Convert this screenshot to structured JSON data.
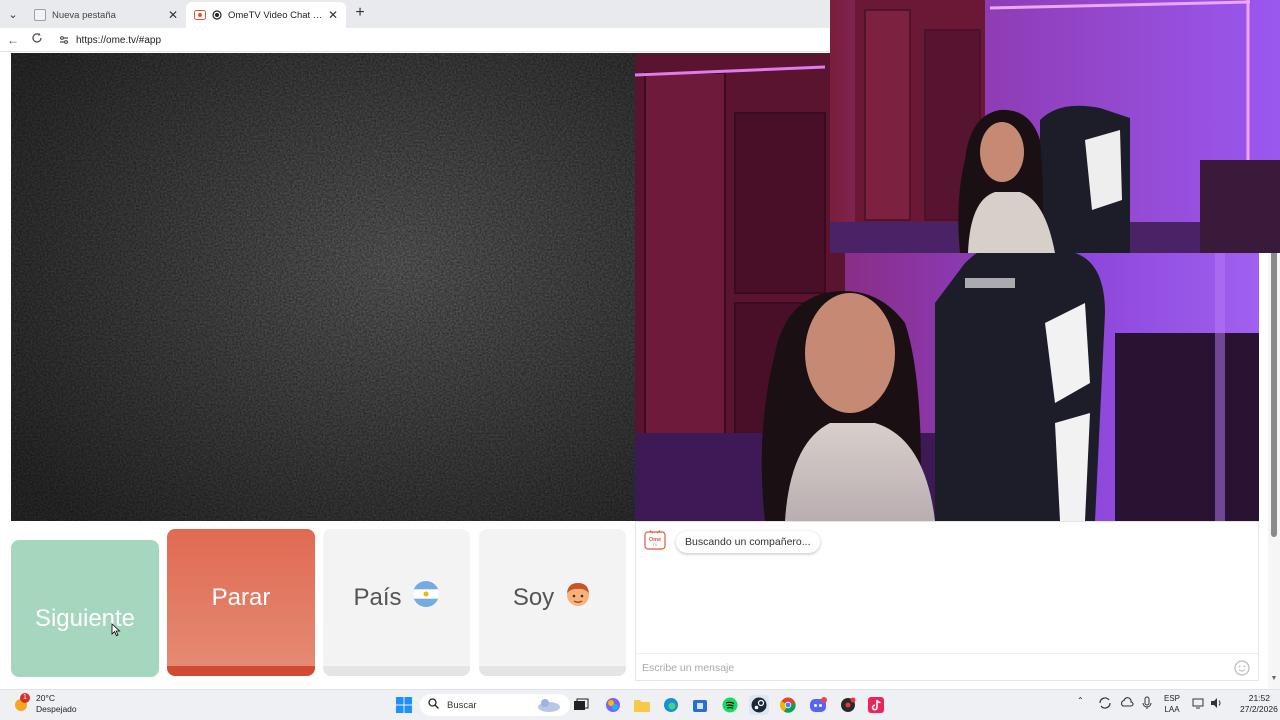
{
  "browser": {
    "tabs": [
      {
        "label": "Nueva pestaña",
        "active": false
      },
      {
        "label": "OmeTV Video Chat — Omeg",
        "active": true
      }
    ],
    "url": "https://ome.tv/#app"
  },
  "controls": {
    "next_label": "Siguiente",
    "stop_label": "Parar",
    "country_label": "País",
    "country_flag": "🇦🇷",
    "gender_label": "Soy",
    "gender_emoji": "👦"
  },
  "chat": {
    "logo_text": "Ome",
    "logo_sub": "TV",
    "status": "Buscando un compañero...",
    "input_placeholder": "Escribe un mensaje"
  },
  "colors": {
    "next": "#a5d7bf",
    "stop": "#e16a52",
    "neutral": "#f3f3f3",
    "room_purple": "#8a3fd6",
    "room_red": "#7a1e3a"
  },
  "taskbar": {
    "weather_temp": "20°C",
    "weather_desc": "Despejado",
    "weather_badge": "1",
    "search_placeholder": "Buscar",
    "lang_top": "ESP",
    "lang_bottom": "LAA",
    "time": "21:52",
    "date": "27/2/2026",
    "icons": [
      "start-icon",
      "search-icon",
      "widgets-icon",
      "task-view-icon",
      "copilot-icon",
      "file-explorer-icon",
      "edge-icon",
      "store-icon",
      "spotify-icon",
      "steam-icon",
      "chrome-icon",
      "discord-icon",
      "app-icon",
      "tiktok-icon"
    ]
  }
}
